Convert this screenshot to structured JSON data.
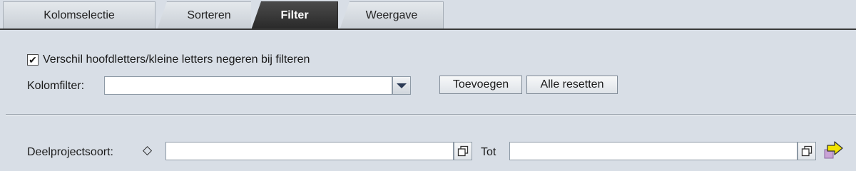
{
  "tabs": [
    {
      "label": "Kolomselectie",
      "active": false
    },
    {
      "label": "Sorteren",
      "active": false
    },
    {
      "label": "Filter",
      "active": true
    },
    {
      "label": "Weergave",
      "active": false
    }
  ],
  "ignore_case": {
    "label": "Verschil hoofdletters/kleine letters negeren bij filteren",
    "checked": true,
    "check_glyph": "✔"
  },
  "column_filter": {
    "label": "Kolomfilter:",
    "value": ""
  },
  "buttons": {
    "add": "Toevoegen",
    "reset_all": "Alle resetten"
  },
  "subproject_type": {
    "label": "Deelprojectsoort:",
    "operator_glyph": "◇",
    "from_value": "",
    "to_label": "Tot",
    "to_value": ""
  },
  "icons": {
    "value_help": "copy-icon",
    "multiple_selection": "arrow-right-icon"
  },
  "colors": {
    "background": "#d8dee6",
    "active_tab": "#2a2a2a",
    "arrow_yellow": "#f2e300"
  }
}
